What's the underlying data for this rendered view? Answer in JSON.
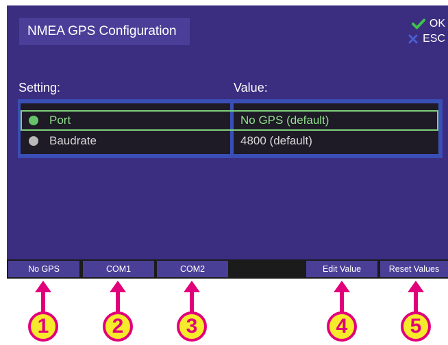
{
  "window": {
    "title": "NMEA GPS Configuration"
  },
  "dialog_actions": {
    "ok_label": "OK",
    "esc_label": "ESC",
    "ok_icon": "check-icon",
    "esc_icon": "x-icon"
  },
  "table": {
    "headers": {
      "setting": "Setting:",
      "value": "Value:"
    },
    "rows": [
      {
        "setting": "Port",
        "value": "No GPS (default)",
        "selected": true
      },
      {
        "setting": "Baudrate",
        "value": "4800 (default)",
        "selected": false
      }
    ]
  },
  "function_keys": [
    {
      "label": "No GPS"
    },
    {
      "label": "COM1"
    },
    {
      "label": "COM2"
    },
    {
      "label": ""
    },
    {
      "label": "Edit Value"
    },
    {
      "label": "Reset Values"
    }
  ],
  "callouts": [
    "1",
    "2",
    "3",
    "4",
    "5"
  ],
  "colors": {
    "background": "#3b2d80",
    "title_box": "#4a3e98",
    "table_border": "#3a4fb6",
    "table_bg": "#1e1a26",
    "selected_text": "#8fe28a",
    "selected_dot": "#66c36a",
    "normal_text": "#d8d8d8",
    "normal_dot": "#b9b9b9",
    "function_key": "#4a3f96",
    "check": "#3fc249",
    "x_icon": "#4b5fcf",
    "callout": "#e2007a",
    "callout_fill": "#f6eb2b"
  }
}
